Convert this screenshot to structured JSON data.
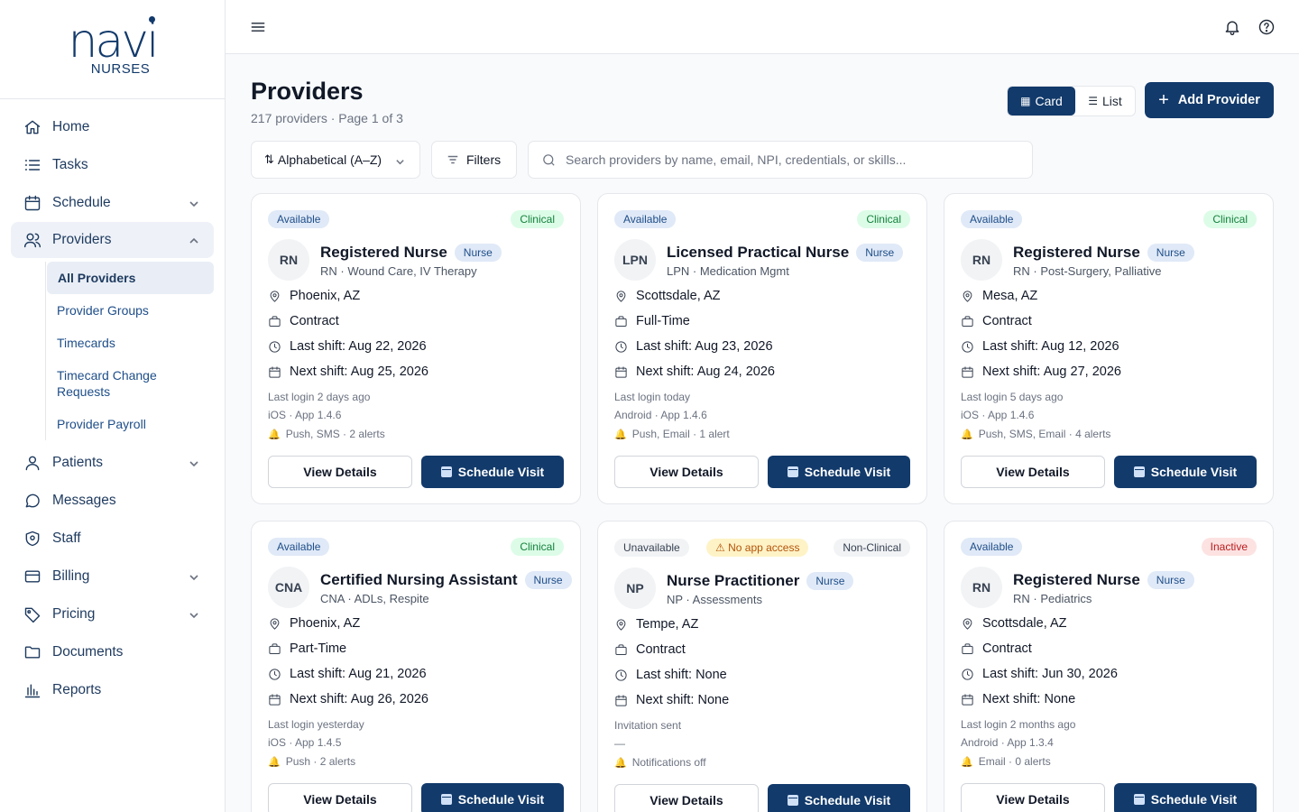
{
  "brand": {
    "word": "navi",
    "sub": "NURSES",
    "color": "#123a6b"
  },
  "nav": {
    "items": [
      {
        "label": "Home",
        "icon": "home-icon"
      },
      {
        "label": "Tasks",
        "icon": "list-icon"
      },
      {
        "label": "Schedule",
        "icon": "calendar-icon"
      },
      {
        "label": "Providers",
        "icon": "users-icon"
      },
      {
        "label": "Patients",
        "icon": "user-icon"
      },
      {
        "label": "Messages",
        "icon": "message-icon"
      },
      {
        "label": "Staff",
        "icon": "shield-icon"
      },
      {
        "label": "Billing",
        "icon": "credit-card-icon"
      },
      {
        "label": "Pricing",
        "icon": "tag-icon"
      },
      {
        "label": "Documents",
        "icon": "folder-icon"
      },
      {
        "label": "Reports",
        "icon": "bar-chart-icon"
      }
    ],
    "providers_sub": [
      "All Providers",
      "Provider Groups",
      "Timecards",
      "Timecard Change Requests",
      "Provider Payroll"
    ]
  },
  "header": {
    "title": "Providers",
    "subtitle": "217 providers · Page 1 of 3",
    "view_card": "Card",
    "view_list": "List",
    "add_label": "Add Provider"
  },
  "toolbar": {
    "sort": "Alphabetical (A–Z)",
    "filters": "Filters",
    "search_placeholder": "Search providers by name, email, NPI, credentials, or skills..."
  },
  "actions": {
    "view": "View Details",
    "schedule": "Schedule Visit"
  },
  "cards": [
    {
      "status": "Available",
      "category": "Clinical",
      "initials": "RN",
      "title": "Registered Nurse",
      "tag": "Nurse",
      "sub": "RN · Wound Care, IV Therapy",
      "location": "Phoenix, AZ",
      "employment": "Contract",
      "last_shift": "Last shift: Aug 22, 2026",
      "next_shift": "Next shift: Aug 25, 2026",
      "login": "Last login 2 days ago",
      "device": "iOS · App 1.4.6",
      "notif": "Push, SMS · 2 alerts"
    },
    {
      "status": "Available",
      "category": "Clinical",
      "initials": "LPN",
      "title": "Licensed Practical Nurse",
      "tag": "Nurse",
      "sub": "LPN · Medication Mgmt",
      "location": "Scottsdale, AZ",
      "employment": "Full-Time",
      "last_shift": "Last shift: Aug 23, 2026",
      "next_shift": "Next shift: Aug 24, 2026",
      "login": "Last login today",
      "device": "Android · App 1.4.6",
      "notif": "Push, Email · 1 alert"
    },
    {
      "status": "Available",
      "category": "Clinical",
      "initials": "RN",
      "title": "Registered Nurse",
      "tag": "Nurse",
      "sub": "RN · Post-Surgery, Palliative",
      "location": "Mesa, AZ",
      "employment": "Contract",
      "last_shift": "Last shift: Aug 12, 2026",
      "next_shift": "Next shift: Aug 27, 2026",
      "login": "Last login 5 days ago",
      "device": "iOS · App 1.4.6",
      "notif": "Push, SMS, Email · 4 alerts"
    },
    {
      "status": "Available",
      "category": "Clinical",
      "initials": "CNA",
      "title": "Certified Nursing Assistant",
      "tag": "Nurse",
      "sub": "CNA · ADLs, Respite",
      "location": "Phoenix, AZ",
      "employment": "Part-Time",
      "last_shift": "Last shift: Aug 21, 2026",
      "next_shift": "Next shift: Aug 26, 2026",
      "login": "Last login yesterday",
      "device": "iOS · App 1.4.5",
      "notif": "Push · 2 alerts"
    },
    {
      "status": "Unavailable",
      "warning": "⚠ No app access",
      "category": "Non-Clinical",
      "initials": "NP",
      "title": "Nurse Practitioner",
      "tag": "Nurse",
      "sub": "NP · Assessments",
      "location": "Tempe, AZ",
      "employment": "Contract",
      "last_shift": "Last shift: None",
      "next_shift": "Next shift: None",
      "login": "Invitation sent",
      "device": "—",
      "notif": "Notifications off"
    },
    {
      "status": "Available",
      "category": "Inactive",
      "initials": "RN",
      "title": "Registered Nurse",
      "tag": "Nurse",
      "sub": "RN · Pediatrics",
      "location": "Scottsdale, AZ",
      "employment": "Contract",
      "last_shift": "Last shift: Jun 30, 2026",
      "next_shift": "Next shift: None",
      "login": "Last login 2 months ago",
      "device": "Android · App 1.3.4",
      "notif": "Email · 0 alerts"
    }
  ]
}
